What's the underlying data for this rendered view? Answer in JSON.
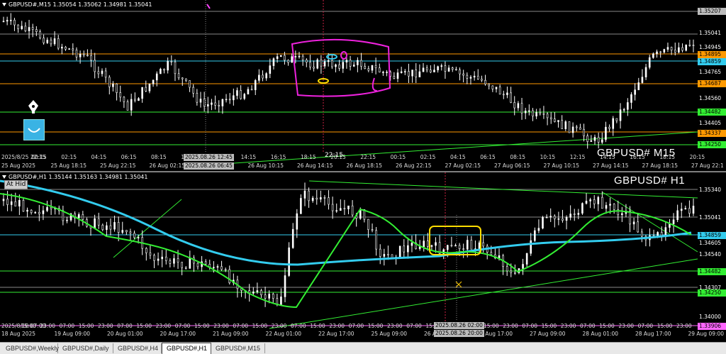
{
  "m15": {
    "title": "GBPUSD#,M15  1.35054 1.35062 1.34981 1.35041",
    "symbol_label": "GBPUSD# M15",
    "price_labels": [
      {
        "text": "1.35207",
        "color": "#bbbbbb",
        "text_color": "#000000"
      },
      {
        "text": "1.35041",
        "color": "#000000",
        "text_color": "#ffffff"
      },
      {
        "text": "1.34945",
        "color": "#000000",
        "text_color": "#ffffff"
      },
      {
        "text": "1.34895",
        "color": "#ff9900",
        "text_color": "#000000"
      },
      {
        "text": "1.34859",
        "color": "#33ccee",
        "text_color": "#000000"
      },
      {
        "text": "1.34765",
        "color": "#000000",
        "text_color": "#ffffff"
      },
      {
        "text": "1.34687",
        "color": "#ff9900",
        "text_color": "#000000"
      },
      {
        "text": "1.34560",
        "color": "#000000",
        "text_color": "#ffffff"
      },
      {
        "text": "1.34482",
        "color": "#33ee33",
        "text_color": "#000000"
      },
      {
        "text": "1.34405",
        "color": "#000000",
        "text_color": "#ffffff"
      },
      {
        "text": "1.34337",
        "color": "#ff9900",
        "text_color": "#000000"
      },
      {
        "text": "1.34250",
        "color": "#33ee33",
        "text_color": "#000000"
      }
    ],
    "time_labels": [
      "2025/8/25 22:15",
      "00:15",
      "02:15",
      "04:15",
      "06:15",
      "08:15",
      "10:15",
      "12:15",
      "14:15",
      "16:15",
      "18:15",
      "20:15",
      "22:15",
      "00:15",
      "02:15",
      "04:15",
      "06:15",
      "08:15",
      "10:15",
      "12:15",
      "14:15",
      "16:15",
      "18:15",
      "20:15"
    ],
    "date_labels": [
      "25 Aug 2025",
      "25 Aug 18:15",
      "25 Aug 22:15",
      "26 Aug 02:15",
      "26 Aug 06:15",
      "26 Aug 10:15",
      "26 Aug 14:15",
      "26 Aug 18:15",
      "26 Aug 22:15",
      "27 Aug 02:15",
      "27 Aug 06:15",
      "27 Aug 10:15",
      "27 Aug 14:15",
      "27 Aug 18:15",
      "27 Aug 22:1"
    ],
    "cursor_time_box": "2025.08.26 12:45",
    "cursor_time_box2": "2025.08.26 06:45",
    "crosshair_label": "22:15"
  },
  "h1": {
    "title": "GBPUSD#,H1  1.35144 1.35163 1.34981 1.35041",
    "symbol_label": "GBPUSD# H1",
    "hide_button": "At Hid",
    "price_labels": [
      {
        "text": "1.35340",
        "color": "#000000",
        "text_color": "#ffffff"
      },
      {
        "text": "1.35041",
        "color": "#000000",
        "text_color": "#ffffff"
      },
      {
        "text": "1.34859",
        "color": "#33ccee",
        "text_color": "#000000"
      },
      {
        "text": "1.34605",
        "color": "#000000",
        "text_color": "#ffffff"
      },
      {
        "text": "1.34540",
        "color": "#000000",
        "text_color": "#ffffff"
      },
      {
        "text": "1.34482",
        "color": "#33ee33",
        "text_color": "#000000"
      },
      {
        "text": "1.34307",
        "color": "#000000",
        "text_color": "#ffffff"
      },
      {
        "text": "1.34250",
        "color": "#33ee33",
        "text_color": "#000000"
      },
      {
        "text": "1.34000",
        "color": "#000000",
        "text_color": "#ffffff"
      },
      {
        "text": "1.33906",
        "color": "#ff66ff",
        "text_color": "#000000"
      }
    ],
    "time_labels": [
      "2025/8/18 07:00",
      "15:00",
      "23:00",
      "07:00",
      "15:00",
      "23:00",
      "07:00",
      "15:00",
      "23:00",
      "07:00",
      "15:00",
      "23:00",
      "07:00",
      "15:00",
      "23:00",
      "07:00",
      "15:00",
      "23:00",
      "07:00",
      "15:00",
      "23:00",
      "07:00",
      "15:00",
      "23:00",
      "07:00",
      "15:00",
      "23:00",
      "07:00",
      "15:00",
      "23:00",
      "07:00",
      "15:00",
      "23:00",
      "07:00",
      "15:00",
      "23:00"
    ],
    "date_labels": [
      "18 Aug 2025",
      "19 Aug 09:00",
      "20 Aug 01:00",
      "20 Aug 17:00",
      "21 Aug 09:00",
      "22 Aug 01:00",
      "22 Aug 17:00",
      "25 Aug 09:00",
      "26 Aug 01:00",
      "26 Aug 17:00",
      "27 Aug 09:00",
      "28 Aug 01:00",
      "28 Aug 17:00",
      "29 Aug 09:00"
    ],
    "cursor_time_box": "2025.08.26 02:00",
    "cursor_time_box2": "2025.08.26 20:00"
  },
  "tabs": [
    "GBPUSD#,Weekly",
    "GBPUSD#,Daily",
    "GBPUSD#,H4",
    "GBPUSD#,H1",
    "GBPUSD#,M15"
  ],
  "active_tab": "GBPUSD#,H1"
}
